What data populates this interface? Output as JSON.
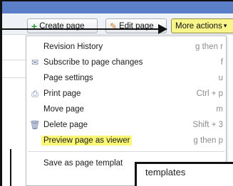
{
  "toolbar": {
    "create_label": "Create page",
    "edit_label": "Edit page",
    "more_label": "More actions",
    "more_accent": "#f8f58a"
  },
  "menu": {
    "items": [
      {
        "label": "Revision History",
        "shortcut": "g then r",
        "icon": ""
      },
      {
        "label": "Subscribe to page changes",
        "shortcut": "f",
        "icon": "envelope-icon"
      },
      {
        "label": "Page settings",
        "shortcut": "u",
        "icon": ""
      },
      {
        "label": "Print page",
        "shortcut": "Ctrl + p",
        "icon": "printer-icon"
      },
      {
        "label": "Move page",
        "shortcut": "m",
        "icon": ""
      },
      {
        "label": "Delete page",
        "shortcut": "Shift + 3",
        "icon": "trash-icon"
      },
      {
        "label": "Preview page as viewer",
        "shortcut": "g then p",
        "icon": "",
        "highlighted": true,
        "highlight_color": "#fbf776"
      },
      {
        "label": "Save as page templat",
        "shortcut": "",
        "icon": ""
      }
    ]
  },
  "tooltip": {
    "text": "templates"
  }
}
